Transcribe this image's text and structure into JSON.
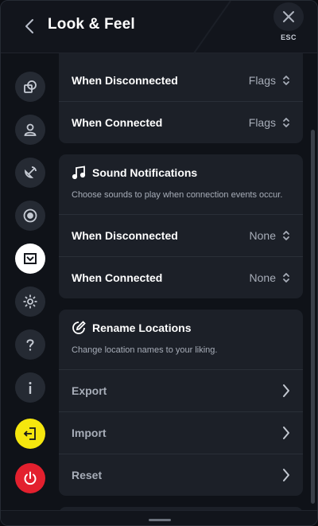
{
  "header": {
    "title": "Look & Feel",
    "esc_label": "ESC"
  },
  "sidebar": {
    "items": [
      {
        "name": "shapes",
        "icon": "shapes-icon"
      },
      {
        "name": "account",
        "icon": "user-icon"
      },
      {
        "name": "connection",
        "icon": "satellite-icon"
      },
      {
        "name": "protocol",
        "icon": "target-icon"
      },
      {
        "name": "look-and-feel",
        "icon": "brand-icon",
        "active": true
      },
      {
        "name": "general",
        "icon": "gear-icon"
      },
      {
        "name": "help",
        "icon": "question-icon"
      },
      {
        "name": "about",
        "icon": "info-icon"
      },
      {
        "name": "sign-out",
        "icon": "logout-icon",
        "color": "#f5e60e"
      },
      {
        "name": "quit",
        "icon": "power-icon",
        "color": "#e3202e"
      }
    ]
  },
  "location_icons": {
    "rows": [
      {
        "label": "When Disconnected",
        "value": "Flags"
      },
      {
        "label": "When Connected",
        "value": "Flags"
      }
    ]
  },
  "sound_notifications": {
    "title": "Sound Notifications",
    "description": "Choose sounds to play when connection events occur.",
    "rows": [
      {
        "label": "When Disconnected",
        "value": "None"
      },
      {
        "label": "When Connected",
        "value": "None"
      }
    ]
  },
  "rename_locations": {
    "title": "Rename Locations",
    "description": "Change location names to your liking.",
    "rows": [
      {
        "label": "Export"
      },
      {
        "label": "Import"
      },
      {
        "label": "Reset"
      }
    ]
  },
  "colors": {
    "accent_yellow": "#f5e60e",
    "accent_red": "#e3202e",
    "card_bg": "#1c2028",
    "panel_bg": "#0f1218"
  }
}
